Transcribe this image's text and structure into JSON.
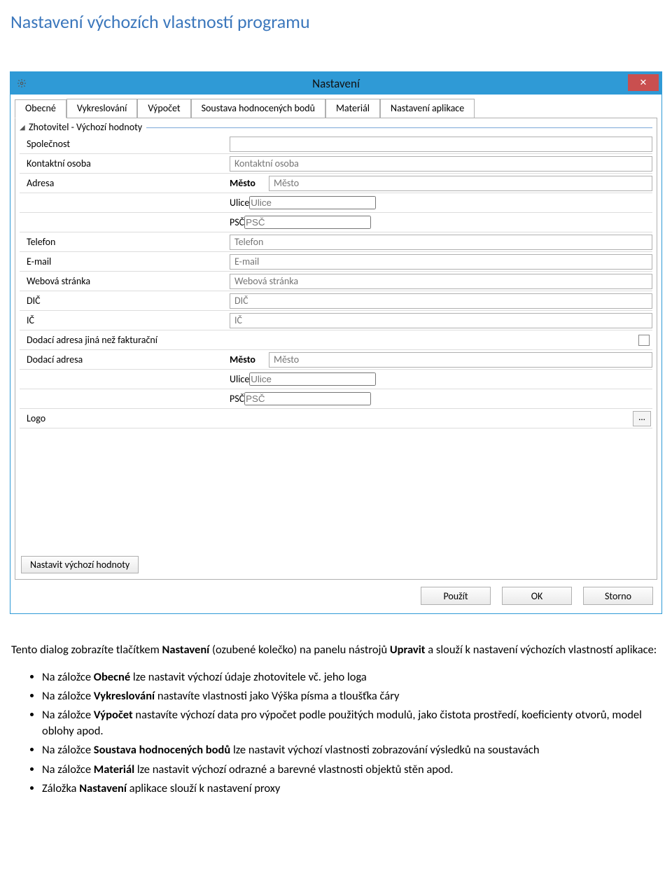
{
  "page": {
    "title": "Nastavení výchozích vlastností programu"
  },
  "dialog": {
    "title": "Nastavení",
    "tabs": [
      "Obecné",
      "Vykreslování",
      "Výpočet",
      "Soustava hodnocených bodů",
      "Materiál",
      "Nastavení aplikace"
    ],
    "group_header": "Zhotovitel - Výchozí hodnoty",
    "fields": {
      "company_label": "Společnost",
      "contact_label": "Kontaktní osoba",
      "contact_ph": "Kontaktní osoba",
      "address_label": "Adresa",
      "city_label": "Město",
      "city_ph": "Město",
      "street_label": "Ulice",
      "street_ph": "Ulice",
      "zip_label": "PSČ",
      "zip_ph": "PSČ",
      "phone_label": "Telefon",
      "phone_ph": "Telefon",
      "email_label": "E-mail",
      "email_ph": "E-mail",
      "web_label": "Webová stránka",
      "web_ph": "Webová stránka",
      "dic_label": "DIČ",
      "dic_ph": "DIČ",
      "ic_label": "IČ",
      "ic_ph": "IČ",
      "deliv_diff_label": "Dodací adresa jiná než fakturační",
      "deliv_label": "Dodací adresa",
      "d_city_label": "Město",
      "d_city_ph": "Město",
      "d_street_label": "Ulice",
      "d_street_ph": "Ulice",
      "d_zip_label": "PSČ",
      "d_zip_ph": "PSČ",
      "logo_label": "Logo",
      "browse_label": "..."
    },
    "defaults_btn": "Nastavit výchozí hodnoty",
    "buttons": {
      "apply": "Použít",
      "ok": "OK",
      "cancel": "Storno"
    }
  },
  "text": {
    "intro_a": "Tento dialog zobrazíte tlačítkem ",
    "intro_b": "Nastavení",
    "intro_c": " (ozubené kolečko) na panelu nástrojů ",
    "intro_d": "Upravit",
    "intro_e": " a slouží k nastavení výchozích vlastností aplikace:",
    "b1a": "Na záložce ",
    "b1b": "Obecné",
    "b1c": " lze nastavit výchozí údaje zhotovitele vč. jeho loga",
    "b2a": "Na záložce ",
    "b2b": "Vykreslování",
    "b2c": " nastavíte vlastnosti jako Výška písma a tloušťka čáry",
    "b3a": "Na záložce ",
    "b3b": "Výpočet",
    "b3c": " nastavíte výchozí data pro výpočet podle použitých modulů, jako čistota prostředí, koeficienty otvorů, model oblohy apod.",
    "b4a": "Na záložce ",
    "b4b": "Soustava hodnocených bodů",
    "b4c": " lze nastavit výchozí vlastnosti zobrazování výsledků na soustavách",
    "b5a": "Na záložce ",
    "b5b": "Materiál",
    "b5c": " lze nastavit výchozí odrazné a barevné vlastnosti objektů stěn apod.",
    "b6a": "Záložka ",
    "b6b": "Nastavení",
    "b6c": " aplikace slouží k nastavení proxy"
  }
}
